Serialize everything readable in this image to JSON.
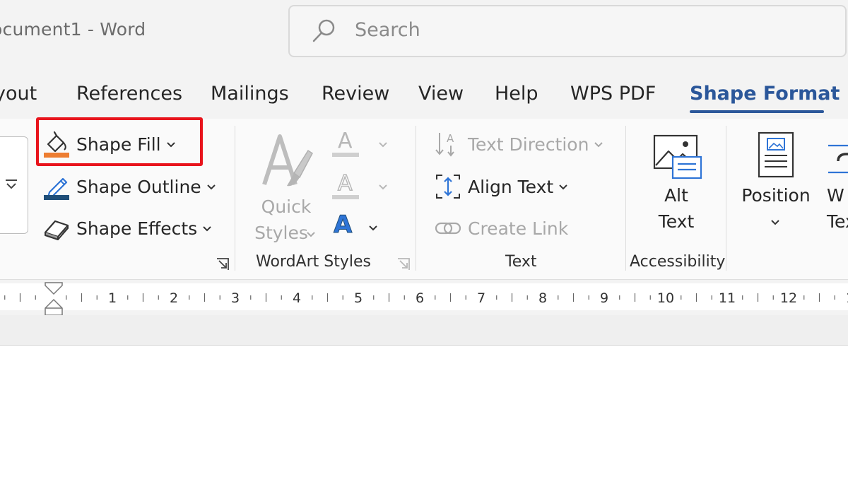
{
  "window": {
    "title": "ocument1  -  Word"
  },
  "search": {
    "placeholder": "Search"
  },
  "tabs": [
    {
      "label": "yout"
    },
    {
      "label": "References"
    },
    {
      "label": "Mailings"
    },
    {
      "label": "Review"
    },
    {
      "label": "View"
    },
    {
      "label": "Help"
    },
    {
      "label": "WPS PDF"
    },
    {
      "label": "Shape Format",
      "active": true
    }
  ],
  "ribbon": {
    "shape_styles": {
      "shape_fill": "Shape Fill",
      "shape_outline": "Shape Outline",
      "shape_effects": "Shape Effects"
    },
    "wordart": {
      "quick_styles_line1": "Quick",
      "quick_styles_line2": "Styles",
      "group_label": "WordArt Styles",
      "glyph": "A"
    },
    "text": {
      "text_direction": "Text Direction",
      "align_text": "Align Text",
      "create_link": "Create Link",
      "group_label": "Text"
    },
    "accessibility": {
      "alt_text_line1": "Alt",
      "alt_text_line2": "Text",
      "group_label": "Accessibility"
    },
    "arrange": {
      "position": "Position",
      "wrap_text_line1": "W",
      "wrap_text_line2": "Tex"
    }
  },
  "ruler": {
    "numbers": [
      "1",
      "2",
      "3",
      "4",
      "5",
      "6",
      "7",
      "8",
      "9",
      "10",
      "11",
      "12",
      "1"
    ]
  },
  "colors": {
    "accent": "#2b579a",
    "fill_bar": "#ed7d31",
    "outline_bar": "#1f4e79",
    "highlight": "#e8141c",
    "wordart_blue": "#2e74d6"
  }
}
